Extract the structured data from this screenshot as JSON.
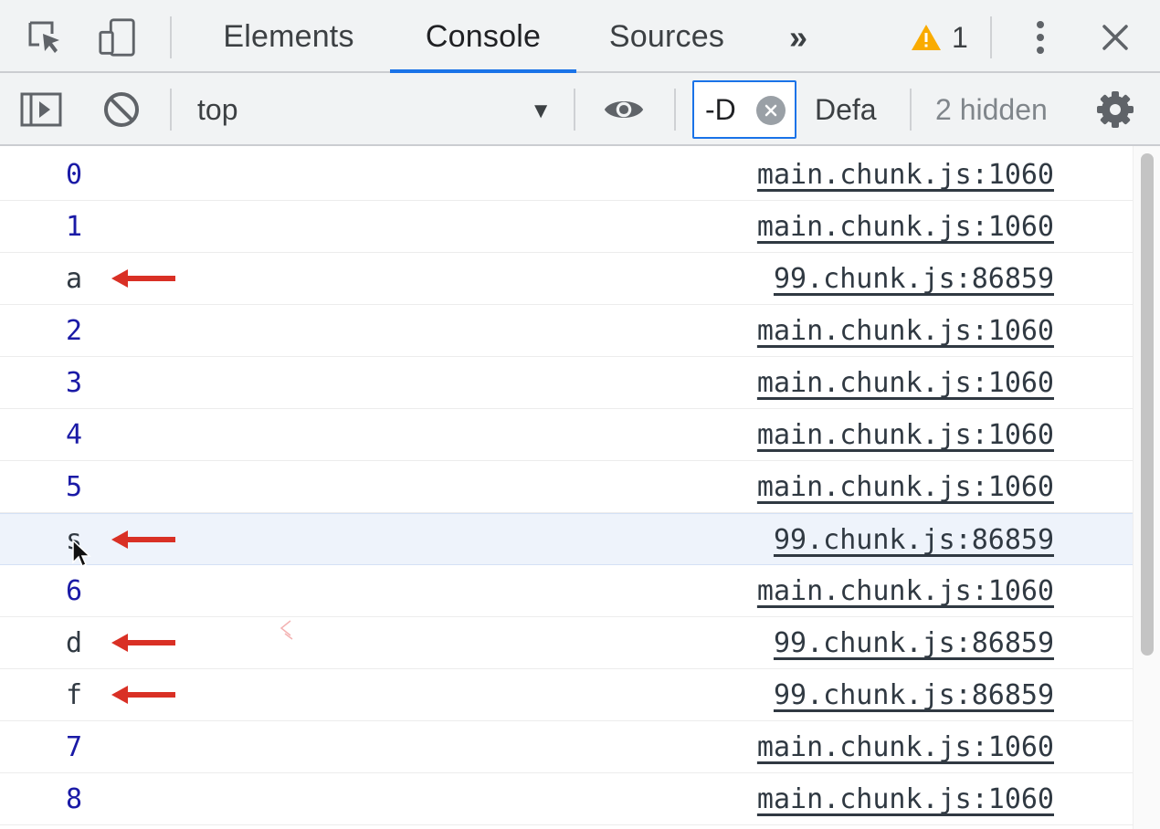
{
  "tabbar": {
    "tabs": [
      {
        "label": "Elements",
        "active": false
      },
      {
        "label": "Console",
        "active": true
      },
      {
        "label": "Sources",
        "active": false
      }
    ],
    "more_tabs_glyph": "»",
    "warning_count": "1",
    "icons": [
      "inspect-element-icon",
      "device-toolbar-icon",
      "more-tabs-icon",
      "warning-icon",
      "kebab-menu-icon",
      "close-icon"
    ]
  },
  "toolbar": {
    "context": "top",
    "filter_value": "-D",
    "log_levels": "Defa",
    "hidden_count": "2 hidden",
    "icons": [
      "sidebar-toggle-icon",
      "clear-console-icon",
      "live-expression-eye-icon",
      "filter-clear-icon",
      "settings-gear-icon"
    ]
  },
  "console": {
    "messages": [
      {
        "text": "0",
        "kind": "num",
        "source": "main.chunk.js:1060",
        "arrow": false
      },
      {
        "text": "1",
        "kind": "num",
        "source": "main.chunk.js:1060",
        "arrow": false
      },
      {
        "text": "a",
        "kind": "str",
        "source": "99.chunk.js:86859",
        "arrow": true
      },
      {
        "text": "2",
        "kind": "num",
        "source": "main.chunk.js:1060",
        "arrow": false
      },
      {
        "text": "3",
        "kind": "num",
        "source": "main.chunk.js:1060",
        "arrow": false
      },
      {
        "text": "4",
        "kind": "num",
        "source": "main.chunk.js:1060",
        "arrow": false
      },
      {
        "text": "5",
        "kind": "num",
        "source": "main.chunk.js:1060",
        "arrow": false
      },
      {
        "text": "s",
        "kind": "str",
        "source": "99.chunk.js:86859",
        "arrow": true,
        "highlighted": true
      },
      {
        "text": "6",
        "kind": "num",
        "source": "main.chunk.js:1060",
        "arrow": false
      },
      {
        "text": "d",
        "kind": "str",
        "source": "99.chunk.js:86859",
        "arrow": true
      },
      {
        "text": "f",
        "kind": "str",
        "source": "99.chunk.js:86859",
        "arrow": true
      },
      {
        "text": "7",
        "kind": "num",
        "source": "main.chunk.js:1060",
        "arrow": false
      },
      {
        "text": "8",
        "kind": "num",
        "source": "main.chunk.js:1060",
        "arrow": false
      }
    ]
  },
  "colors": {
    "accent": "#1a73e8",
    "annotation_arrow": "#d93025",
    "number_text": "#1a1aa6",
    "warning": "#f9ab00"
  }
}
